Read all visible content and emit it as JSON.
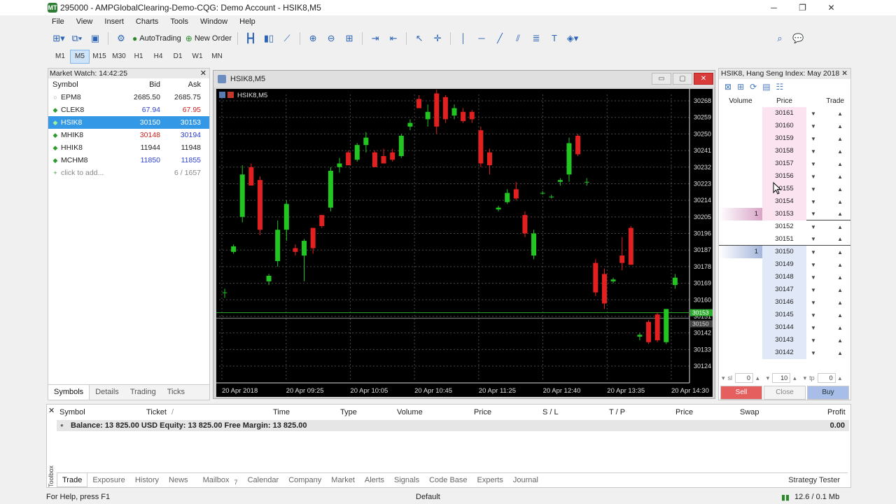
{
  "window": {
    "title": "295000 - AMPGlobalClearing-Demo-CQG: Demo Account - HSIK8,M5",
    "icon": "MT",
    "min": "─",
    "max": "❐",
    "close": "✕"
  },
  "menu": [
    "File",
    "View",
    "Insert",
    "Charts",
    "Tools",
    "Window",
    "Help"
  ],
  "toolbar": {
    "autotrading": "AutoTrading",
    "new_order": "New Order"
  },
  "timeframes": [
    "M1",
    "M5",
    "M15",
    "M30",
    "H1",
    "H4",
    "D1",
    "W1",
    "MN"
  ],
  "market_watch": {
    "title": "Market Watch: 14:42:25",
    "close": "✕",
    "columns": [
      "Symbol",
      "Bid",
      "Ask"
    ],
    "rows": [
      {
        "symbol": "EPM8",
        "bid": "2685.50",
        "ask": "2685.75",
        "bid_color": "#222222",
        "ask_color": "#222222",
        "dot": "grey"
      },
      {
        "symbol": "CLEK8",
        "bid": "67.94",
        "ask": "67.95",
        "bid_color": "#2a3fd0",
        "ask_color": "#d02020",
        "dot": "green"
      },
      {
        "symbol": "HSIK8",
        "bid": "30150",
        "ask": "30153",
        "bid_color": "#ffffff",
        "ask_color": "#ffffff",
        "dot": "green",
        "selected": true
      },
      {
        "symbol": "MHIK8",
        "bid": "30148",
        "ask": "30194",
        "bid_color": "#d02020",
        "ask_color": "#2a3fd0",
        "dot": "green"
      },
      {
        "symbol": "HHIK8",
        "bid": "11944",
        "ask": "11948",
        "bid_color": "#222222",
        "ask_color": "#222222",
        "dot": "green"
      },
      {
        "symbol": "MCHM8",
        "bid": "11850",
        "ask": "11855",
        "bid_color": "#2a3fd0",
        "ask_color": "#2a3fd0",
        "dot": "green"
      }
    ],
    "add_label": "click to add...",
    "count": "6 / 1657",
    "tabs": [
      "Symbols",
      "Details",
      "Trading",
      "Ticks"
    ]
  },
  "chart": {
    "window_title": "HSIK8,M5",
    "label": "HSIK8,M5",
    "btn_min": "▭",
    "btn_max": "▢",
    "btn_close": "✕"
  },
  "chart_data": {
    "type": "candlestick",
    "title": "HSIK8,M5",
    "ylim": [
      30118,
      30272
    ],
    "y_ticks": [
      "30268",
      "30259",
      "30250",
      "30241",
      "30232",
      "30223",
      "30214",
      "30205",
      "30196",
      "30187",
      "30178",
      "30169",
      "30160",
      "30151",
      "30142",
      "30133",
      "30124"
    ],
    "x_ticks": [
      "20 Apr 2018",
      "20 Apr 09:25",
      "20 Apr 10:05",
      "20 Apr 10:45",
      "20 Apr 11:25",
      "20 Apr 12:40",
      "20 Apr 13:35",
      "20 Apr 14:30"
    ],
    "price_labels": [
      "30153",
      "30150"
    ],
    "candles": [
      {
        "o": 30164,
        "h": 30166,
        "l": 30161,
        "c": 30164
      },
      {
        "o": 30186,
        "h": 30190,
        "l": 30185,
        "c": 30189
      },
      {
        "o": 30205,
        "h": 30233,
        "l": 30202,
        "c": 30228
      },
      {
        "o": 30232,
        "h": 30234,
        "l": 30222,
        "c": 30222
      },
      {
        "o": 30225,
        "h": 30227,
        "l": 30195,
        "c": 30198
      },
      {
        "o": 30170,
        "h": 30174,
        "l": 30168,
        "c": 30173
      },
      {
        "o": 30181,
        "h": 30203,
        "l": 30178,
        "c": 30198
      },
      {
        "o": 30198,
        "h": 30214,
        "l": 30192,
        "c": 30212
      },
      {
        "o": 30188,
        "h": 30190,
        "l": 30184,
        "c": 30186
      },
      {
        "o": 30184,
        "h": 30193,
        "l": 30170,
        "c": 30192
      },
      {
        "o": 30199,
        "h": 30199,
        "l": 30185,
        "c": 30188
      },
      {
        "o": 30206,
        "h": 30206,
        "l": 30199,
        "c": 30200
      },
      {
        "o": 30210,
        "h": 30232,
        "l": 30208,
        "c": 30230
      },
      {
        "o": 30232,
        "h": 30237,
        "l": 30229,
        "c": 30234
      },
      {
        "o": 30240,
        "h": 30241,
        "l": 30233,
        "c": 30233
      },
      {
        "o": 30236,
        "h": 30245,
        "l": 30235,
        "c": 30244
      },
      {
        "o": 30244,
        "h": 30251,
        "l": 30240,
        "c": 30248
      },
      {
        "o": 30240,
        "h": 30241,
        "l": 30232,
        "c": 30232
      },
      {
        "o": 30238,
        "h": 30242,
        "l": 30234,
        "c": 30234
      },
      {
        "o": 30240,
        "h": 30242,
        "l": 30235,
        "c": 30236
      },
      {
        "o": 30238,
        "h": 30250,
        "l": 30237,
        "c": 30249
      },
      {
        "o": 30254,
        "h": 30258,
        "l": 30252,
        "c": 30256
      },
      {
        "o": 30269,
        "h": 30271,
        "l": 30264,
        "c": 30264
      },
      {
        "o": 30258,
        "h": 30266,
        "l": 30254,
        "c": 30262
      },
      {
        "o": 30272,
        "h": 30274,
        "l": 30250,
        "c": 30254
      },
      {
        "o": 30270,
        "h": 30271,
        "l": 30256,
        "c": 30258
      },
      {
        "o": 30260,
        "h": 30266,
        "l": 30258,
        "c": 30264
      },
      {
        "o": 30262,
        "h": 30264,
        "l": 30256,
        "c": 30257
      },
      {
        "o": 30262,
        "h": 30263,
        "l": 30256,
        "c": 30258
      },
      {
        "o": 30252,
        "h": 30254,
        "l": 30232,
        "c": 30234
      },
      {
        "o": 30240,
        "h": 30242,
        "l": 30228,
        "c": 30233
      },
      {
        "o": 30209,
        "h": 30211,
        "l": 30208,
        "c": 30210
      },
      {
        "o": 30213,
        "h": 30220,
        "l": 30212,
        "c": 30218
      },
      {
        "o": 30220,
        "h": 30224,
        "l": 30214,
        "c": 30215
      },
      {
        "o": 30206,
        "h": 30208,
        "l": 30194,
        "c": 30196
      },
      {
        "o": 30184,
        "h": 30198,
        "l": 30182,
        "c": 30196
      },
      {
        "o": 30218,
        "h": 30219,
        "l": 30217,
        "c": 30218
      },
      {
        "o": 30216,
        "h": 30217,
        "l": 30215,
        "c": 30216
      },
      {
        "o": 30224,
        "h": 30226,
        "l": 30222,
        "c": 30225
      },
      {
        "o": 30228,
        "h": 30248,
        "l": 30224,
        "c": 30245
      },
      {
        "o": 30249,
        "h": 30250,
        "l": 30238,
        "c": 30239
      },
      {
        "o": 30224,
        "h": 30226,
        "l": 30222,
        "c": 30224
      },
      {
        "o": 30180,
        "h": 30182,
        "l": 30162,
        "c": 30164
      },
      {
        "o": 30174,
        "h": 30177,
        "l": 30155,
        "c": 30158
      },
      {
        "o": 30170,
        "h": 30172,
        "l": 30169,
        "c": 30171
      },
      {
        "o": 30184,
        "h": 30194,
        "l": 30176,
        "c": 30180
      },
      {
        "o": 30199,
        "h": 30200,
        "l": 30179,
        "c": 30179
      },
      {
        "o": 30140,
        "h": 30142,
        "l": 30138,
        "c": 30141
      },
      {
        "o": 30148,
        "h": 30149,
        "l": 30136,
        "c": 30137
      },
      {
        "o": 30152,
        "h": 30153,
        "l": 30137,
        "c": 30138
      },
      {
        "o": 30137,
        "h": 30155,
        "l": 30136,
        "c": 30155
      },
      {
        "o": 30168,
        "h": 30174,
        "l": 30166,
        "c": 30172
      }
    ]
  },
  "dom": {
    "title": "HSIK8, Hang Seng Index: May 2018",
    "close": "✕",
    "columns": [
      "Volume",
      "Price",
      "Trade"
    ],
    "rows": [
      {
        "price": "30161",
        "side": "ask",
        "vol": ""
      },
      {
        "price": "30160",
        "side": "ask",
        "vol": ""
      },
      {
        "price": "30159",
        "side": "ask",
        "vol": ""
      },
      {
        "price": "30158",
        "side": "ask",
        "vol": ""
      },
      {
        "price": "30157",
        "side": "ask",
        "vol": ""
      },
      {
        "price": "30156",
        "side": "ask",
        "vol": ""
      },
      {
        "price": "30155",
        "side": "ask",
        "vol": ""
      },
      {
        "price": "30154",
        "side": "ask",
        "vol": ""
      },
      {
        "price": "30153",
        "side": "ask",
        "vol": "1"
      },
      {
        "price": "30152",
        "side": "mid",
        "vol": ""
      },
      {
        "price": "30151",
        "side": "mid",
        "vol": ""
      },
      {
        "price": "30150",
        "side": "bid",
        "vol": "1"
      },
      {
        "price": "30149",
        "side": "bid",
        "vol": ""
      },
      {
        "price": "30148",
        "side": "bid",
        "vol": ""
      },
      {
        "price": "30147",
        "side": "bid",
        "vol": ""
      },
      {
        "price": "30146",
        "side": "bid",
        "vol": ""
      },
      {
        "price": "30145",
        "side": "bid",
        "vol": ""
      },
      {
        "price": "30144",
        "side": "bid",
        "vol": ""
      },
      {
        "price": "30143",
        "side": "bid",
        "vol": ""
      },
      {
        "price": "30142",
        "side": "bid",
        "vol": ""
      }
    ],
    "sl_label": "sl",
    "sl_value": "0",
    "volume_value": "10",
    "tp_label": "tp",
    "tp_value": "0",
    "sell": "Sell",
    "close_btn": "Close",
    "buy": "Buy"
  },
  "terminal": {
    "columns": [
      "Symbol",
      "Ticket",
      "/",
      "Time",
      "Type",
      "Volume",
      "Price",
      "S / L",
      "T / P",
      "Price",
      "Swap",
      "Profit"
    ],
    "balance_text": "Balance: 13 825.00 USD  Equity: 13 825.00  Free Margin: 13 825.00",
    "profit": "0.00",
    "toolbox_label": "Toolbox",
    "tabs": [
      "Trade",
      "Exposure",
      "History",
      "News",
      "Mailbox",
      "Calendar",
      "Company",
      "Market",
      "Alerts",
      "Signals",
      "Code Base",
      "Experts",
      "Journal"
    ],
    "mailbox_count": "7",
    "strategy_tester": "Strategy Tester"
  },
  "status": {
    "help": "For Help, press F1",
    "profile": "Default",
    "traffic": "12.6 / 0.1 Mb"
  }
}
